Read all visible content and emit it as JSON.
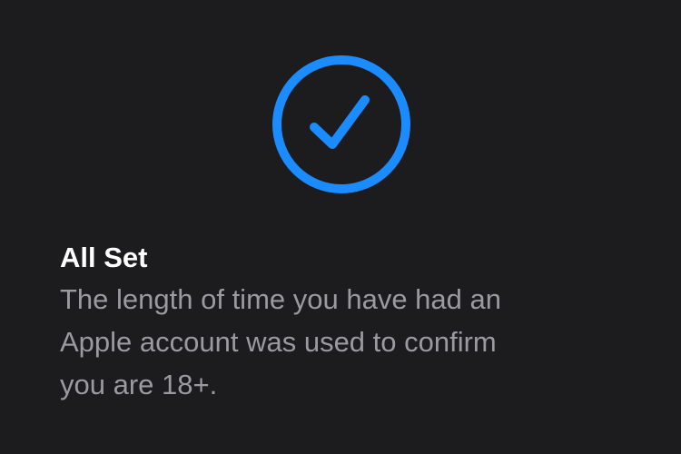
{
  "status": {
    "icon": "checkmark-circle-icon",
    "accent_color": "#1a8cff",
    "background_color": "#1c1c1e",
    "title": "All Set",
    "message_lines": [
      "The length of time you have had an",
      "Apple account was used to confirm",
      "you are 18+."
    ]
  }
}
